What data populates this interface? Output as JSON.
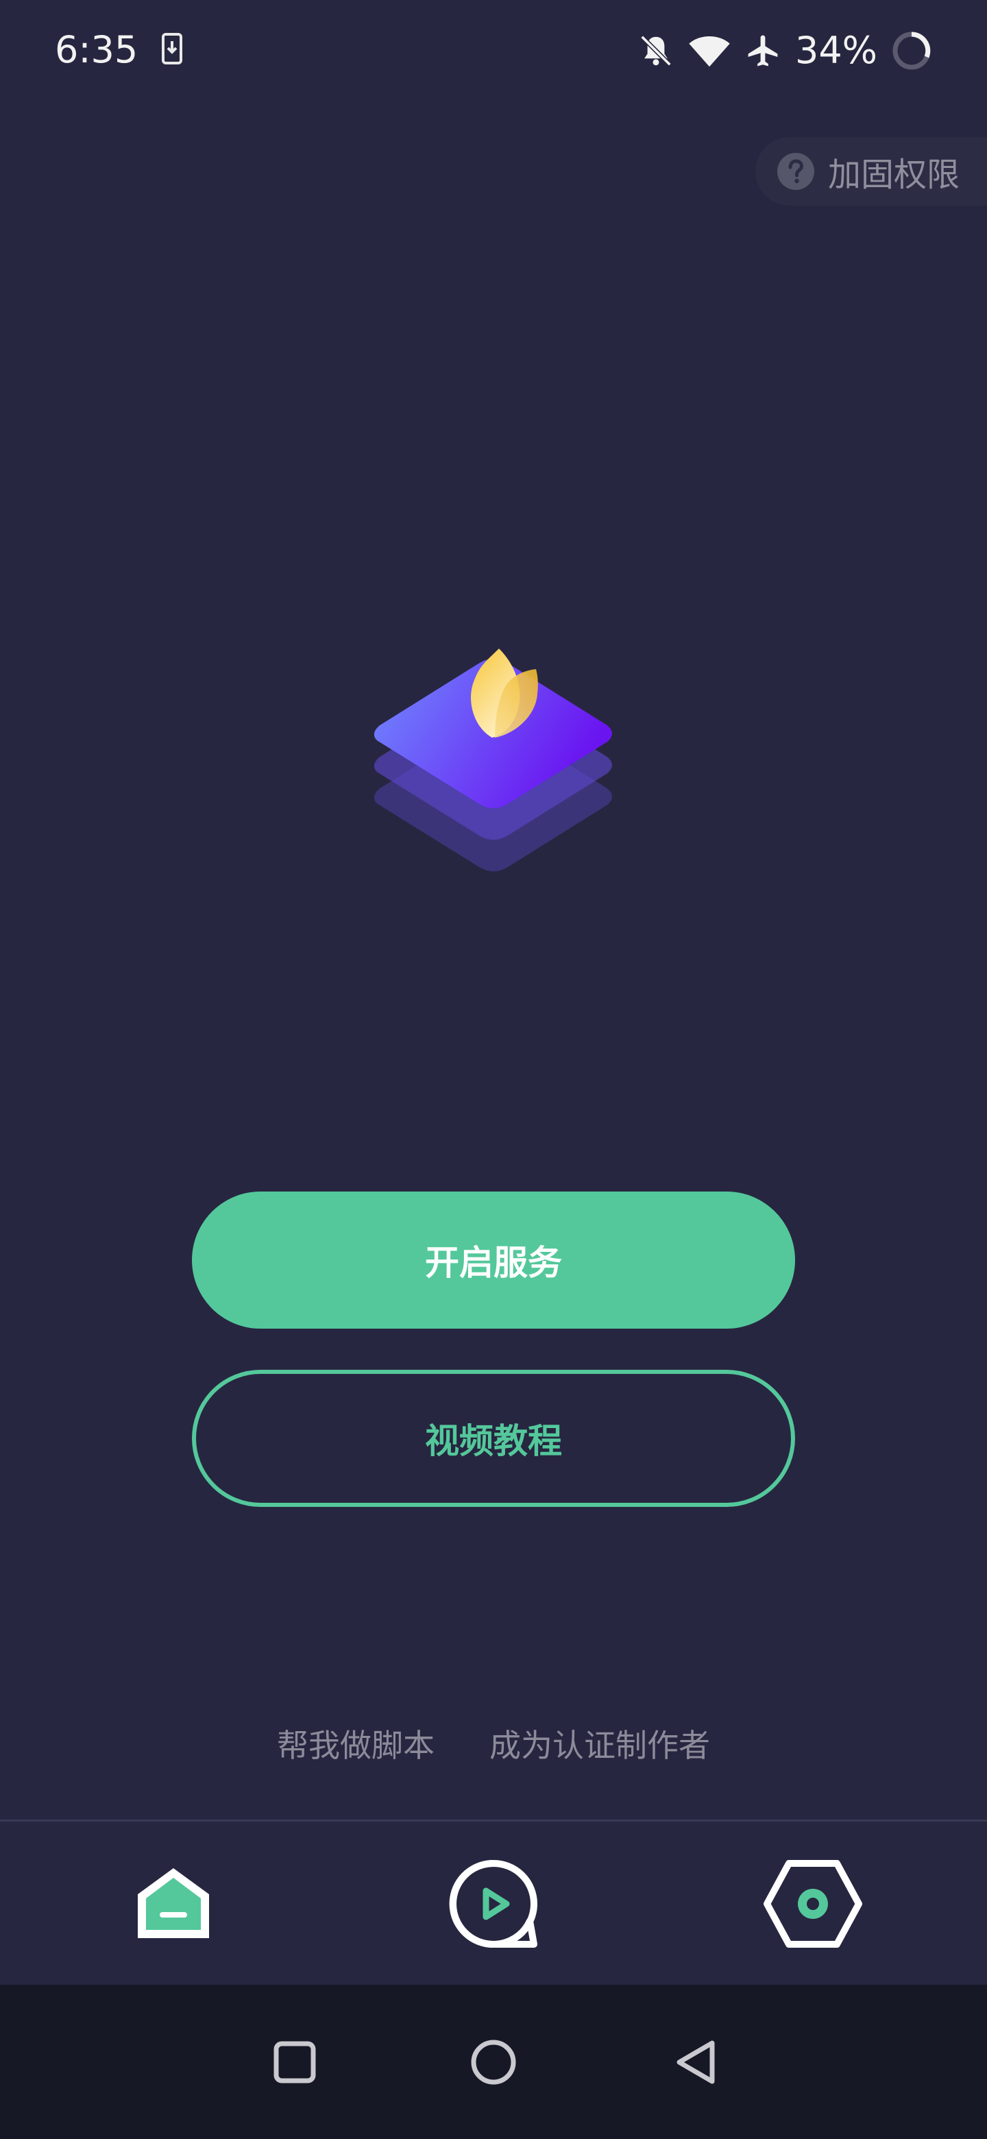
{
  "status_bar": {
    "time": "6:35",
    "battery_percent": "34%",
    "icons": [
      "download-icon",
      "bell-off-icon",
      "wifi-icon",
      "airplane-icon",
      "battery-ring-icon"
    ]
  },
  "permission": {
    "label": "加固权限",
    "icon": "help-circle-icon"
  },
  "buttons": {
    "start_service": "开启服务",
    "video_tutorial": "视频教程"
  },
  "footer_links": {
    "help_script": "帮我做脚本",
    "become_author": "成为认证制作者"
  },
  "bottom_nav": {
    "items": [
      "home-icon",
      "play-icon",
      "settings-icon"
    ]
  },
  "colors": {
    "background": "#272640",
    "accent": "#54c89b",
    "muted_text": "#8b8b9a",
    "system_nav": "#171826"
  }
}
